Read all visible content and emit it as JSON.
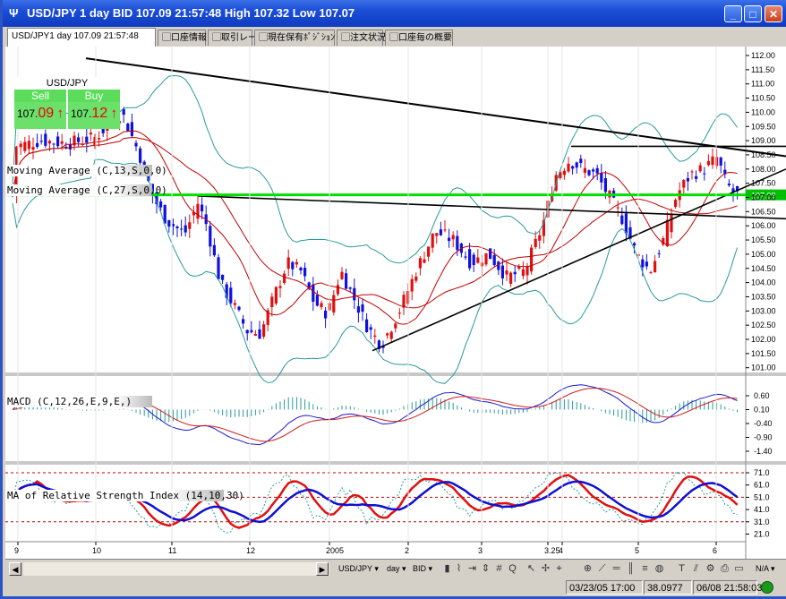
{
  "window": {
    "title": "USD/JPY 1 day BID 107.09 21:57:48 High 107.32 Low 107.07",
    "icon": "trident-app-icon",
    "minimize": "_",
    "maximize": "□",
    "close": "✕"
  },
  "tabs": [
    {
      "label": "USD/JPY1 day 107.09 21:57:48",
      "icon": ""
    },
    {
      "label": "口座情報",
      "icon": "tab-doc-icon"
    },
    {
      "label": "取引レート",
      "icon": "tab-doc-icon"
    },
    {
      "label": "現在保有ﾎﾟｼﾞｼｮﾝ",
      "icon": "tab-doc-icon"
    },
    {
      "label": "注文状況",
      "icon": "tab-doc-icon"
    },
    {
      "label": "口座毎の概要",
      "icon": "tab-doc-icon"
    }
  ],
  "quote": {
    "symbol": "USD/JPY",
    "sell_label": "Sell",
    "buy_label": "Buy",
    "sell_prefix": "107.",
    "sell_big": "09",
    "buy_prefix": "107.",
    "buy_big": "12",
    "arrow": "↑"
  },
  "indicators": {
    "ma13": "Moving Average (C,13,S,0,0)",
    "ma27": "Moving Average (C,27,S,0,0)",
    "macd": "MACD (C,12,26,E,9,E,)",
    "rsi": "MA of Relative Strength Index (14,10,30)"
  },
  "price_axis": [
    "112.00",
    "111.50",
    "111.00",
    "110.50",
    "110.00",
    "109.50",
    "109.00",
    "108.50",
    "108.00",
    "107.50",
    "107.00",
    "106.50",
    "106.00",
    "105.50",
    "105.00",
    "104.50",
    "104.00",
    "103.50",
    "103.00",
    "102.50",
    "102.00",
    "101.50",
    "101.00"
  ],
  "price_marker": "107.09",
  "macd_axis": [
    "0.60",
    "0.10",
    "-0.40",
    "-0.90",
    "-1.40"
  ],
  "rsi_axis": [
    "71.0",
    "61.0",
    "51.0",
    "41.0",
    "31.0",
    "21.0"
  ],
  "time_axis": [
    "9",
    "10",
    "11",
    "12",
    "2005",
    "2",
    "3",
    "3.25",
    "4",
    "5",
    "6"
  ],
  "bottom_bar": {
    "symbol_select": "USD/JPY",
    "period_select": "day",
    "side_select": "BID",
    "zoom_select": "N/A"
  },
  "status": {
    "datetime": "03/23/05 17:00",
    "value": "38.0977",
    "clock": "06/08 21:58:03"
  },
  "colors": {
    "bull_candle": "#e01010",
    "bear_candle": "#1010e0",
    "bollinger": "#2a9a9a",
    "ma_line": "#c00000",
    "price_line": "#00e000",
    "marker_bg": "#00c000"
  }
}
